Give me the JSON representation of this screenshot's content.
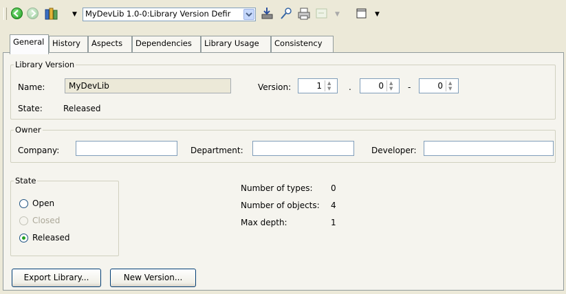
{
  "toolbar": {
    "combo_value": "MyDevLib 1.0-0:Library Version Defir",
    "icons": [
      "back-icon",
      "forward-icon",
      "library-icon",
      "chevron-down-icon",
      "export-icon",
      "pin-icon",
      "print-icon",
      "disabled-icon",
      "window-icon"
    ]
  },
  "tabs": [
    {
      "label": "General",
      "active": true
    },
    {
      "label": "History"
    },
    {
      "label": "Aspects"
    },
    {
      "label": "Dependencies"
    },
    {
      "label": "Library Usage"
    },
    {
      "label": "Consistency"
    }
  ],
  "library_version": {
    "legend": "Library Version",
    "name_label": "Name:",
    "name_value": "MyDevLib",
    "version_label": "Version:",
    "major": "1",
    "sep1": ".",
    "minor": "0",
    "sep2": "-",
    "patch": "0",
    "state_label": "State:",
    "state_value": "Released"
  },
  "owner": {
    "legend": "Owner",
    "company_label": "Company:",
    "company_value": "",
    "department_label": "Department:",
    "department_value": "",
    "developer_label": "Developer:",
    "developer_value": ""
  },
  "state": {
    "legend": "State",
    "options": [
      {
        "label": "Open",
        "checked": false,
        "enabled": true
      },
      {
        "label": "Closed",
        "checked": false,
        "enabled": false
      },
      {
        "label": "Released",
        "checked": true,
        "enabled": true
      }
    ]
  },
  "stats": {
    "types_label": "Number of types:",
    "types_value": "0",
    "objects_label": "Number of objects:",
    "objects_value": "4",
    "depth_label": "Max depth:",
    "depth_value": "1"
  },
  "buttons": {
    "export": "Export Library...",
    "new_version": "New Version..."
  },
  "colors": {
    "background": "#ece9d8",
    "panel": "#f5f4ee",
    "field_border": "#7f9db9",
    "radio_dot": "#21a121"
  }
}
